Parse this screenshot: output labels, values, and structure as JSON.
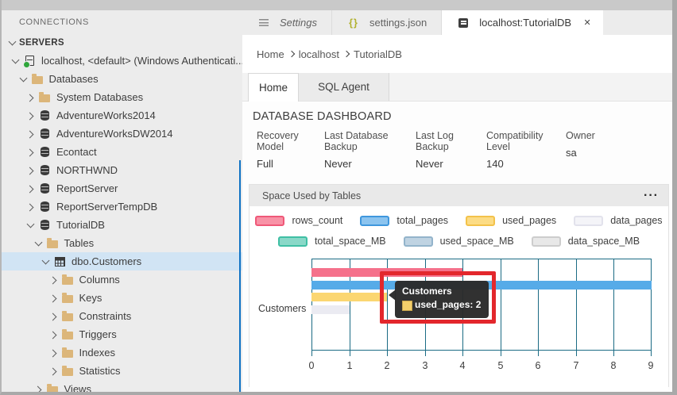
{
  "window": {
    "accent_blue": "#0f72c4"
  },
  "sidebar": {
    "title": "CONNECTIONS",
    "section": "SERVERS",
    "tree": [
      {
        "label": "localhost, <default> (Windows Authenticati...",
        "icon": "server",
        "expanded": true,
        "level": 0,
        "selected": false
      },
      {
        "label": "Databases",
        "icon": "folder",
        "expanded": true,
        "level": 1,
        "selected": false
      },
      {
        "label": "System Databases",
        "icon": "folder",
        "expanded": false,
        "level": 2,
        "selected": false
      },
      {
        "label": "AdventureWorks2014",
        "icon": "database",
        "expanded": false,
        "level": 2,
        "selected": false
      },
      {
        "label": "AdventureWorksDW2014",
        "icon": "database",
        "expanded": false,
        "level": 2,
        "selected": false
      },
      {
        "label": "Econtact",
        "icon": "database",
        "expanded": false,
        "level": 2,
        "selected": false
      },
      {
        "label": "NORTHWND",
        "icon": "database",
        "expanded": false,
        "level": 2,
        "selected": false
      },
      {
        "label": "ReportServer",
        "icon": "database",
        "expanded": false,
        "level": 2,
        "selected": false
      },
      {
        "label": "ReportServerTempDB",
        "icon": "database",
        "expanded": false,
        "level": 2,
        "selected": false
      },
      {
        "label": "TutorialDB",
        "icon": "database",
        "expanded": true,
        "level": 2,
        "selected": false
      },
      {
        "label": "Tables",
        "icon": "folder",
        "expanded": true,
        "level": 3,
        "selected": false
      },
      {
        "label": "dbo.Customers",
        "icon": "table",
        "expanded": true,
        "level": 4,
        "selected": true
      },
      {
        "label": "Columns",
        "icon": "folder",
        "expanded": false,
        "level": 5,
        "selected": false
      },
      {
        "label": "Keys",
        "icon": "folder",
        "expanded": false,
        "level": 5,
        "selected": false
      },
      {
        "label": "Constraints",
        "icon": "folder",
        "expanded": false,
        "level": 5,
        "selected": false
      },
      {
        "label": "Triggers",
        "icon": "folder",
        "expanded": false,
        "level": 5,
        "selected": false
      },
      {
        "label": "Indexes",
        "icon": "folder",
        "expanded": false,
        "level": 5,
        "selected": false
      },
      {
        "label": "Statistics",
        "icon": "folder",
        "expanded": false,
        "level": 5,
        "selected": false
      },
      {
        "label": "Views",
        "icon": "folder",
        "expanded": false,
        "level": 3,
        "selected": false
      }
    ]
  },
  "tabs": [
    {
      "label": "Settings",
      "icon": "settings-list",
      "italic": true,
      "active": false,
      "closable": false
    },
    {
      "label": "settings.json",
      "icon": "json-braces",
      "italic": false,
      "active": false,
      "closable": false
    },
    {
      "label": "localhost:TutorialDB",
      "icon": "dashboard",
      "italic": false,
      "active": true,
      "closable": true
    }
  ],
  "breadcrumb": {
    "items": [
      "Home",
      "localhost",
      "TutorialDB"
    ]
  },
  "subtabs": [
    {
      "label": "Home",
      "active": true
    },
    {
      "label": "SQL Agent",
      "active": false
    }
  ],
  "dashboard": {
    "title": "DATABASE DASHBOARD",
    "properties": [
      {
        "label": "Recovery Model",
        "value": "Full"
      },
      {
        "label": "Last Database Backup",
        "value": "Never"
      },
      {
        "label": "Last Log Backup",
        "value": "Never"
      },
      {
        "label": "Compatibility Level",
        "value": "140"
      },
      {
        "label": "Owner",
        "value": "sa"
      }
    ]
  },
  "widget": {
    "title": "Space Used by Tables"
  },
  "chart_data": {
    "type": "bar",
    "orientation": "horizontal",
    "title": "Space Used by Tables",
    "categories": [
      "Customers"
    ],
    "series": [
      {
        "name": "rows_count",
        "values": [
          4
        ],
        "color": "#f5718b",
        "legend_fill": "#f892a6",
        "legend_border": "#ef5878"
      },
      {
        "name": "total_pages",
        "values": [
          9
        ],
        "color": "#56abe8",
        "legend_fill": "#8cc4ef",
        "legend_border": "#3f97dd"
      },
      {
        "name": "used_pages",
        "values": [
          2
        ],
        "color": "#fbd671",
        "legend_fill": "#fcdc85",
        "legend_border": "#f3c24a"
      },
      {
        "name": "data_pages",
        "values": [
          1
        ],
        "color": "#ebebf2",
        "legend_fill": "#f4f4f8",
        "legend_border": "#e2e2ec"
      },
      {
        "name": "total_space_MB",
        "values": [
          0
        ],
        "color": "#62cbb5",
        "legend_fill": "#8ad8c8",
        "legend_border": "#3fbfa4"
      },
      {
        "name": "used_space_MB",
        "values": [
          0
        ],
        "color": "#afc9dc",
        "legend_fill": "#bfd3e2",
        "legend_border": "#93b4cb"
      },
      {
        "name": "data_space_MB",
        "values": [
          0
        ],
        "color": "#dcdcdc",
        "legend_fill": "#e8e8e8",
        "legend_border": "#cdcdcd"
      }
    ],
    "xlim": [
      0,
      9
    ],
    "xticks": [
      0,
      1,
      2,
      3,
      4,
      5,
      6,
      7,
      8,
      9
    ],
    "grid": true,
    "grid_color": "#1b6b84",
    "legend_position": "top",
    "legend_rows": [
      [
        "rows_count",
        "total_pages",
        "used_pages",
        "data_pages"
      ],
      [
        "total_space_MB",
        "used_space_MB",
        "data_space_MB"
      ]
    ]
  },
  "tooltip": {
    "title": "Customers",
    "text": "used_pages: 2",
    "swatch_color": "#f4cf6b"
  },
  "annotation": {
    "color": "#e3272c"
  }
}
